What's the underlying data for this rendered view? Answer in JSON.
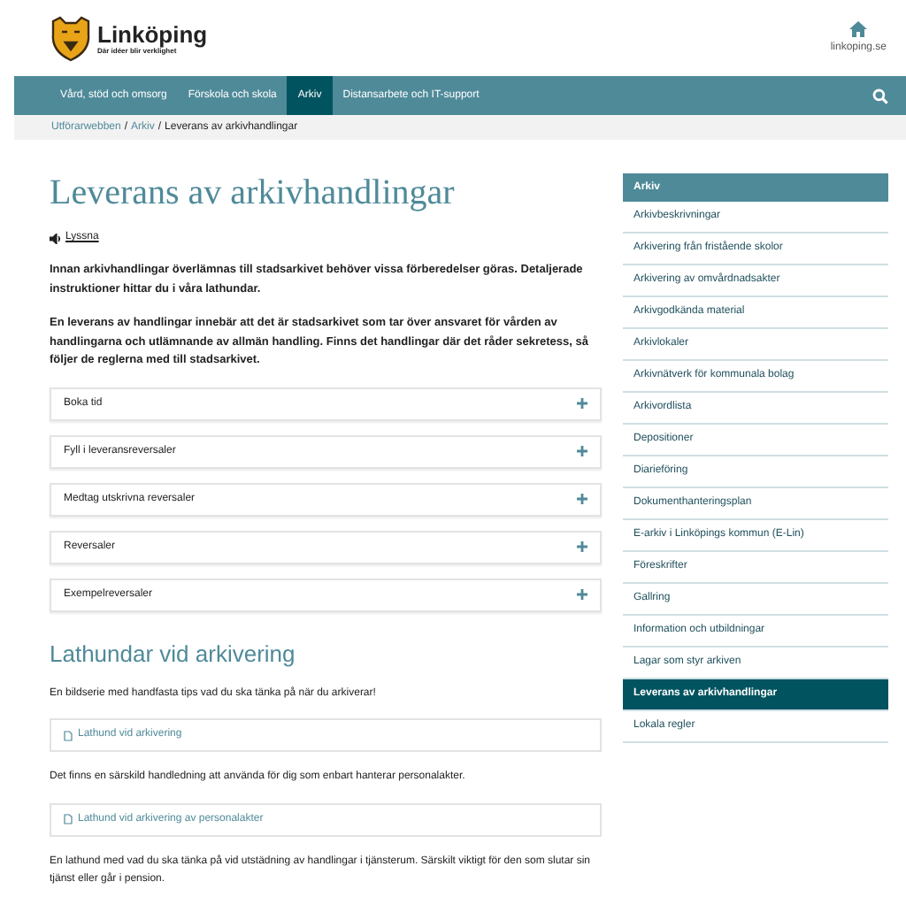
{
  "brand": {
    "name": "Linköping",
    "tagline": "Där idéer blir verklighet"
  },
  "home_link": {
    "label": "linkoping.se"
  },
  "nav": [
    {
      "label": "Vård, stöd och omsorg",
      "selected": false
    },
    {
      "label": "Förskola och skola",
      "selected": false
    },
    {
      "label": "Arkiv",
      "selected": true
    },
    {
      "label": "Distansarbete och IT-support",
      "selected": false
    }
  ],
  "breadcrumb": [
    {
      "label": "Utförarwebben",
      "kind": "link"
    },
    {
      "label": "/",
      "kind": "separator"
    },
    {
      "label": "Arkiv",
      "kind": "link"
    },
    {
      "label": "/",
      "kind": "separator"
    },
    {
      "label": "Leverans av arkivhandlingar",
      "kind": "current"
    }
  ],
  "title": "Leverans av arkivhandlingar",
  "listen": "Lyssna",
  "intro": [
    "Innan arkivhandlingar överlämnas till stadsarkivet behöver vissa förberedelser göras. Detaljerade instruktioner hittar du i våra lathundar.",
    "En leverans av handlingar innebär att det är stadsarkivet som tar över ansvaret för vården av handlingarna och utlämnande av allmän handling. Finns det handlingar där det råder sekretess, så följer de reglerna med till stadsarkivet."
  ],
  "accordion": [
    {
      "label": "Boka tid",
      "expanded": false
    },
    {
      "label": "Fyll i leveransreversaler",
      "expanded": false
    },
    {
      "label": "Medtag utskrivna reversaler",
      "expanded": false
    },
    {
      "label": "Reversaler",
      "expanded": false
    },
    {
      "label": "Exempelreversaler",
      "expanded": false
    }
  ],
  "section": {
    "heading": "Lathundar vid arkivering",
    "blocks": [
      {
        "kind": "text",
        "text": "En bildserie med handfasta tips vad du ska tänka på när du arkiverar!"
      },
      {
        "kind": "file",
        "text": "Lathund vid arkivering"
      },
      {
        "kind": "text",
        "text": "Det finns en särskild handledning att använda för dig som enbart hanterar personalakter."
      },
      {
        "kind": "file",
        "text": "Lathund vid arkivering av personalakter"
      },
      {
        "kind": "text",
        "text": "En lathund med vad du ska tänka på vid utstädning av handlingar i tjänsterum. Särskilt viktigt för den som slutar sin tjänst eller går i pension."
      }
    ]
  },
  "sidebar": {
    "heading": "Arkiv",
    "items": [
      {
        "label": "Arkivbeskrivningar",
        "selected": false
      },
      {
        "label": "Arkivering från fristående skolor",
        "selected": false
      },
      {
        "label": "Arkivering av omvårdnadsakter",
        "selected": false
      },
      {
        "label": "Arkivgodkända material",
        "selected": false
      },
      {
        "label": "Arkivlokaler",
        "selected": false
      },
      {
        "label": "Arkivnätverk för kommunala bolag",
        "selected": false
      },
      {
        "label": "Arkivordlista",
        "selected": false
      },
      {
        "label": "Depositioner",
        "selected": false
      },
      {
        "label": "Diarieföring",
        "selected": false
      },
      {
        "label": "Dokumenthanteringsplan",
        "selected": false
      },
      {
        "label": "E-arkiv i Linköpings kommun (E-Lin)",
        "selected": false
      },
      {
        "label": "Föreskrifter",
        "selected": false
      },
      {
        "label": "Gallring",
        "selected": false
      },
      {
        "label": "Information och utbildningar",
        "selected": false
      },
      {
        "label": "Lagar som styr arkiven",
        "selected": false
      },
      {
        "label": "Leverans av arkivhandlingar",
        "selected": true
      },
      {
        "label": "Lokala regler",
        "selected": false
      }
    ]
  }
}
